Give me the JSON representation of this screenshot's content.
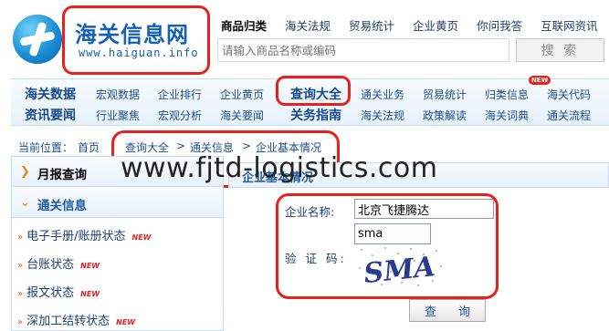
{
  "logo": {
    "title": "海关信息网",
    "url": "www.haiguan.info"
  },
  "topnav": {
    "items": [
      "商品归类",
      "海关法规",
      "贸易统计",
      "企业黄页",
      "你问我答",
      "互联网资讯"
    ]
  },
  "search": {
    "placeholder": "请输入商品名称或编码",
    "button": "搜 索"
  },
  "mainnav": {
    "row1": {
      "head": "海关数据",
      "items": [
        "宏观数据",
        "企业排行",
        "企业黄页",
        "查询大全",
        "通关业务",
        "贸易统计",
        "归类信息",
        "海关代码"
      ]
    },
    "row2": {
      "head": "资讯要闻",
      "items": [
        "行业聚焦",
        "宏观分析",
        "海关要闻",
        "关务指南",
        "海关法规",
        "政策解读",
        "海关词典",
        "通关流程"
      ]
    },
    "new_tag": "NEW"
  },
  "breadcrumb": {
    "label": "当前位置：",
    "home": "首页",
    "items": [
      "查询大全",
      "通关信息",
      "企业基本情况"
    ],
    "sep": ">"
  },
  "watermark": "www.fjtd-logistics.com",
  "sidebar": {
    "monthly": "月报查询",
    "customs": "通关信息",
    "items": [
      {
        "label": "电子手册/账册状态",
        "new": "NEW"
      },
      {
        "label": "台账状态",
        "new": "NEW"
      },
      {
        "label": "报文状态",
        "new": "NEW"
      },
      {
        "label": "深加工结转状态",
        "new": "NEW"
      }
    ]
  },
  "panel": {
    "title": "企业基本情况",
    "company_label": "企业名称:",
    "company_value": "北京飞捷腾达",
    "captcha_value": "sma",
    "captcha_label": "验 证 码:",
    "captcha_image_text": "SMA",
    "query_button": "查 询"
  },
  "colors": {
    "highlight": "#e8201e",
    "link": "#1f4f8f",
    "brand": "#1560b7"
  }
}
